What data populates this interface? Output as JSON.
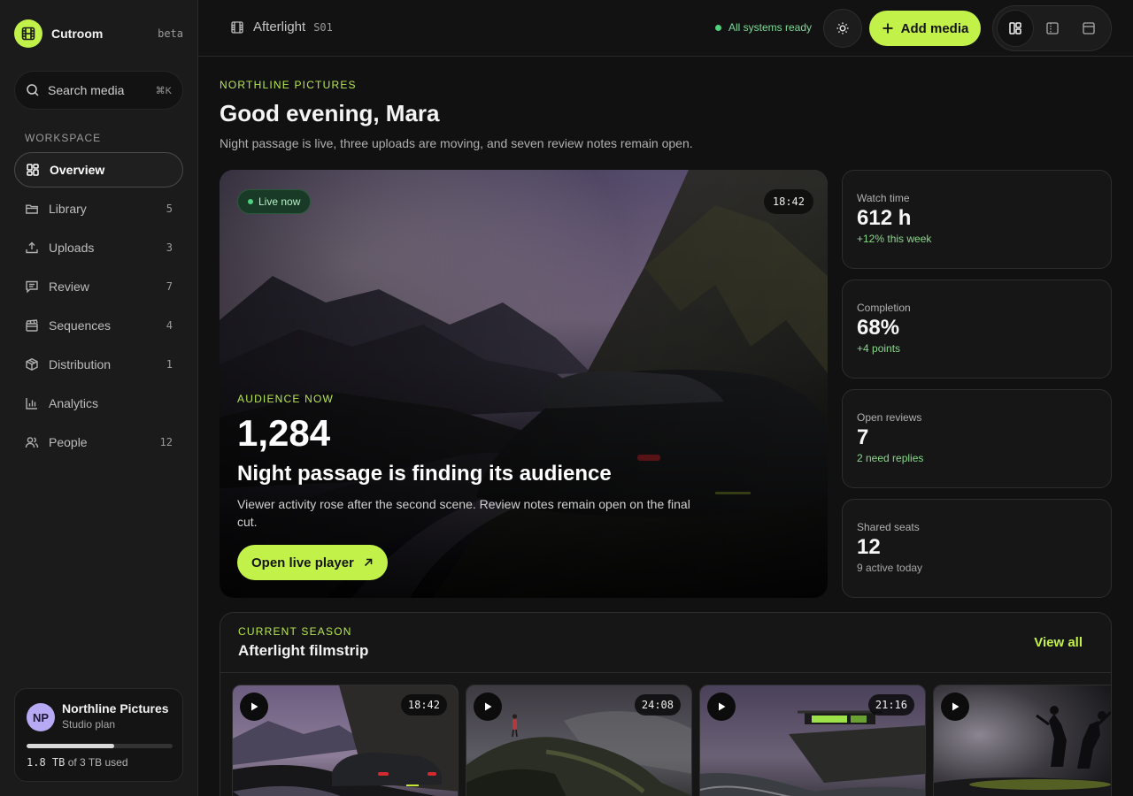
{
  "app": {
    "name": "Cutroom",
    "badge": "beta"
  },
  "search": {
    "placeholder": "Search media",
    "shortcut": "⌘K"
  },
  "sidebar": {
    "section_label": "WORKSPACE",
    "items": [
      {
        "label": "Overview",
        "count": "",
        "icon": "overview-icon",
        "active": true
      },
      {
        "label": "Library",
        "count": "5",
        "icon": "folder-icon"
      },
      {
        "label": "Uploads",
        "count": "3",
        "icon": "upload-icon"
      },
      {
        "label": "Review",
        "count": "7",
        "icon": "review-icon"
      },
      {
        "label": "Sequences",
        "count": "4",
        "icon": "clapperboard-icon"
      },
      {
        "label": "Distribution",
        "count": "1",
        "icon": "package-icon"
      },
      {
        "label": "Analytics",
        "count": "",
        "icon": "bar-chart-icon"
      },
      {
        "label": "People",
        "count": "12",
        "icon": "people-icon"
      }
    ]
  },
  "org": {
    "initials": "NP",
    "name": "Northline Pictures",
    "plan": "Studio plan",
    "usage_amount": "1.8 TB",
    "usage_suffix": "of 3 TB used",
    "usage_fraction": 0.6
  },
  "header": {
    "breadcrumb": "Afterlight",
    "episode": "S01",
    "status": "All systems ready",
    "add_label": "Add media"
  },
  "main": {
    "eyebrow": "NORTHLINE PICTURES",
    "greeting": "Good evening, Mara",
    "intro": "Night passage is live, three uploads are moving, and seven review notes remain open."
  },
  "hero": {
    "live_label": "Live now",
    "duration": "18:42",
    "eyebrow": "AUDIENCE NOW",
    "count": "1,284",
    "title": "Night passage is finding its audience",
    "description": "Viewer activity rose after the second scene. Review notes remain open on the final cut.",
    "cta": "Open live player"
  },
  "stats": [
    {
      "label": "Watch time",
      "value": "612 h",
      "note": "+12% this week",
      "accent": true
    },
    {
      "label": "Completion",
      "value": "68%",
      "note": "+4 points",
      "accent": true
    },
    {
      "label": "Open reviews",
      "value": "7",
      "note": "2 need replies",
      "accent": true
    },
    {
      "label": "Shared seats",
      "value": "12",
      "note": "9 active today",
      "accent": false
    }
  ],
  "season": {
    "eyebrow": "CURRENT SEASON",
    "title": "Afterlight filmstrip",
    "view_all": "View all",
    "films": [
      {
        "duration": "18:42"
      },
      {
        "duration": "24:08"
      },
      {
        "duration": "21:16"
      },
      {
        "duration": ""
      }
    ]
  },
  "colors": {
    "accent": "#c2f24a",
    "background": "#111111",
    "sidebar": "#1b1b1b",
    "live": "#4fd27e"
  }
}
